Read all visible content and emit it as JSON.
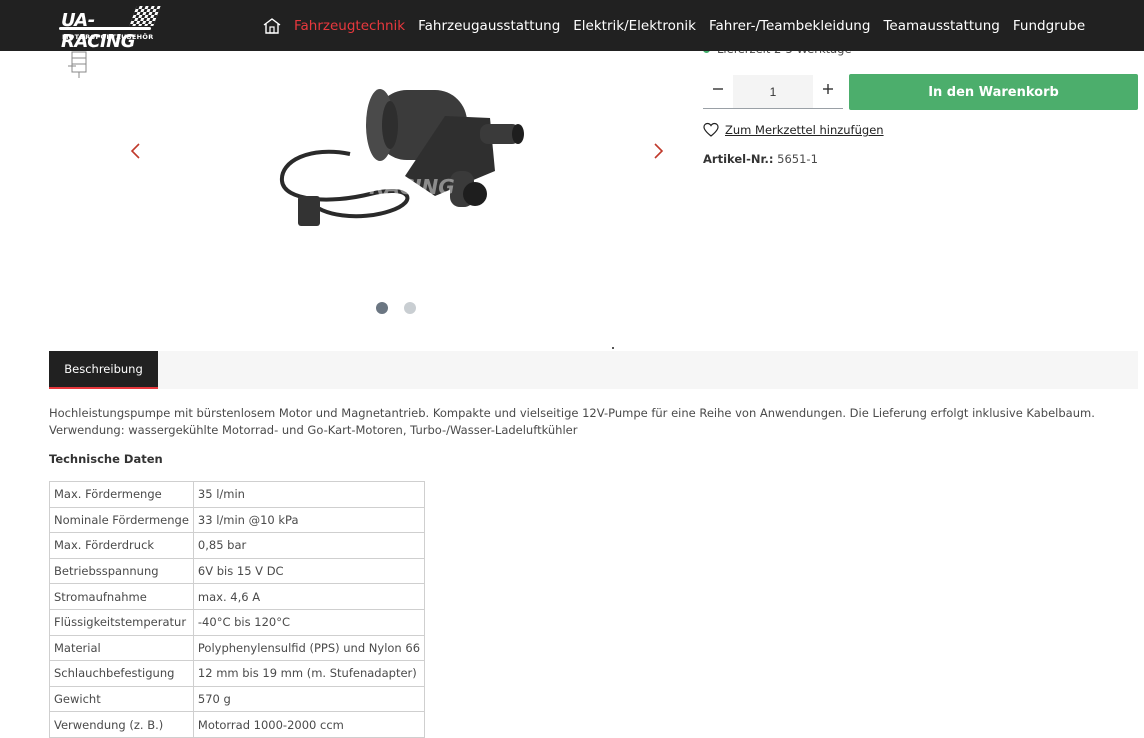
{
  "brand": {
    "logo_name": "UA-RACING",
    "logo_tagline": "MOTORSPORTZUBEHÖR"
  },
  "nav": {
    "home_icon": "home-icon",
    "items": [
      {
        "label": "Fahrzeugtechnik",
        "active": true
      },
      {
        "label": "Fahrzeugausstattung",
        "active": false
      },
      {
        "label": "Elektrik/Elektronik",
        "active": false
      },
      {
        "label": "Fahrer-/Teambekleidung",
        "active": false
      },
      {
        "label": "Teamausstattung",
        "active": false
      },
      {
        "label": "Fundgrube",
        "active": false
      }
    ]
  },
  "gallery": {
    "slide_count": 2,
    "active_slide": 1
  },
  "buybox": {
    "delivery_text": "Lieferzeit 2-5 Werktage",
    "quantity": "1",
    "cart_label": "In den Warenkorb",
    "wishlist_label": "Zum Merkzettel hinzufügen",
    "article_label": "Artikel-Nr.:",
    "article_number": "5651-1"
  },
  "tabs": {
    "description": "Beschreibung"
  },
  "description": {
    "line1": "Hochleistungspumpe mit bürstenlosem Motor und Magnetantrieb. Kompakte und vielseitige 12V-Pumpe für eine Reihe von Anwendungen. Die Lieferung erfolgt inklusive Kabelbaum.",
    "line2": "Verwendung: wassergekühlte Motorrad- und Go-Kart-Motoren, Turbo-/Wasser-Ladeluftkühler",
    "tech_heading": "Technische Daten"
  },
  "specs": [
    {
      "key": "Max. Fördermenge",
      "value": "35 l/min"
    },
    {
      "key": "Nominale Fördermenge",
      "value": "33 l/min @10 kPa"
    },
    {
      "key": "Max. Förderdruck",
      "value": "0,85 bar"
    },
    {
      "key": "Betriebsspannung",
      "value": "6V bis 15 V DC"
    },
    {
      "key": "Stromaufnahme",
      "value": "max. 4,6 A"
    },
    {
      "key": "Flüssigkeitstemperatur",
      "value": "-40°C bis 120°C"
    },
    {
      "key": "Material",
      "value": "Polyphenylensulfid (PPS) und Nylon 66"
    },
    {
      "key": "Schlauchbefestigung",
      "value": "12 mm bis 19 mm (m. Stufenadapter)"
    },
    {
      "key": "Gewicht",
      "value": "570 g"
    },
    {
      "key": "Verwendung (z. B.)",
      "value": "Motorrad 1000-2000 ccm"
    }
  ],
  "colors": {
    "header": "#212121",
    "accent": "#e8383d",
    "cart": "#4cae6c",
    "in_stock": "#3fae6a"
  }
}
